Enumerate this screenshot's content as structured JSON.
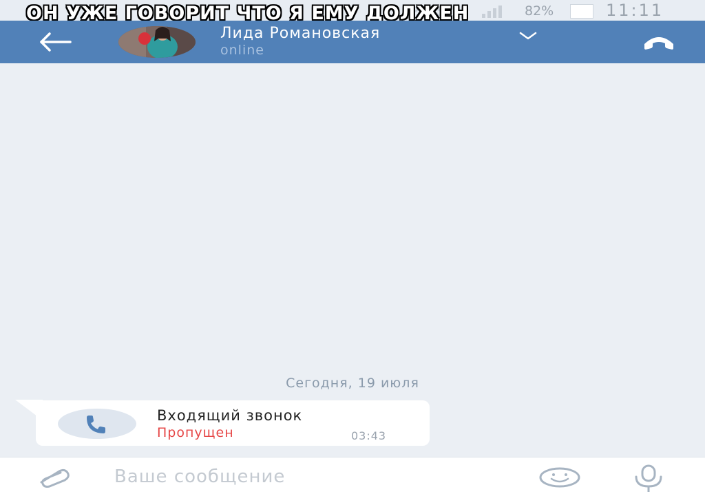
{
  "caption": "ОН УЖЕ ГОВОРИТ ЧТО Я ЕМУ ДОЛЖЕН",
  "status_bar": {
    "battery_percent": "82%",
    "time": "11:11"
  },
  "header": {
    "contact_name": "Лида Романовская",
    "contact_status": "online"
  },
  "chat": {
    "date_separator": "Сегодня, 19 июля",
    "messages": [
      {
        "type": "call",
        "title": "Входящий звонок",
        "status": "Пропущен",
        "time": "03:43",
        "status_color": "#e64646"
      }
    ]
  },
  "composer": {
    "placeholder": "Ваше сообщение"
  },
  "colors": {
    "header_bg": "#5181b8",
    "chat_bg": "#ebeff4",
    "missed_red": "#e64646"
  },
  "icons": [
    "back-arrow-icon",
    "chevron-down-icon",
    "phone-icon",
    "paperclip-icon",
    "smile-icon",
    "microphone-icon",
    "wifi-icon",
    "signal-icon",
    "battery-icon"
  ]
}
